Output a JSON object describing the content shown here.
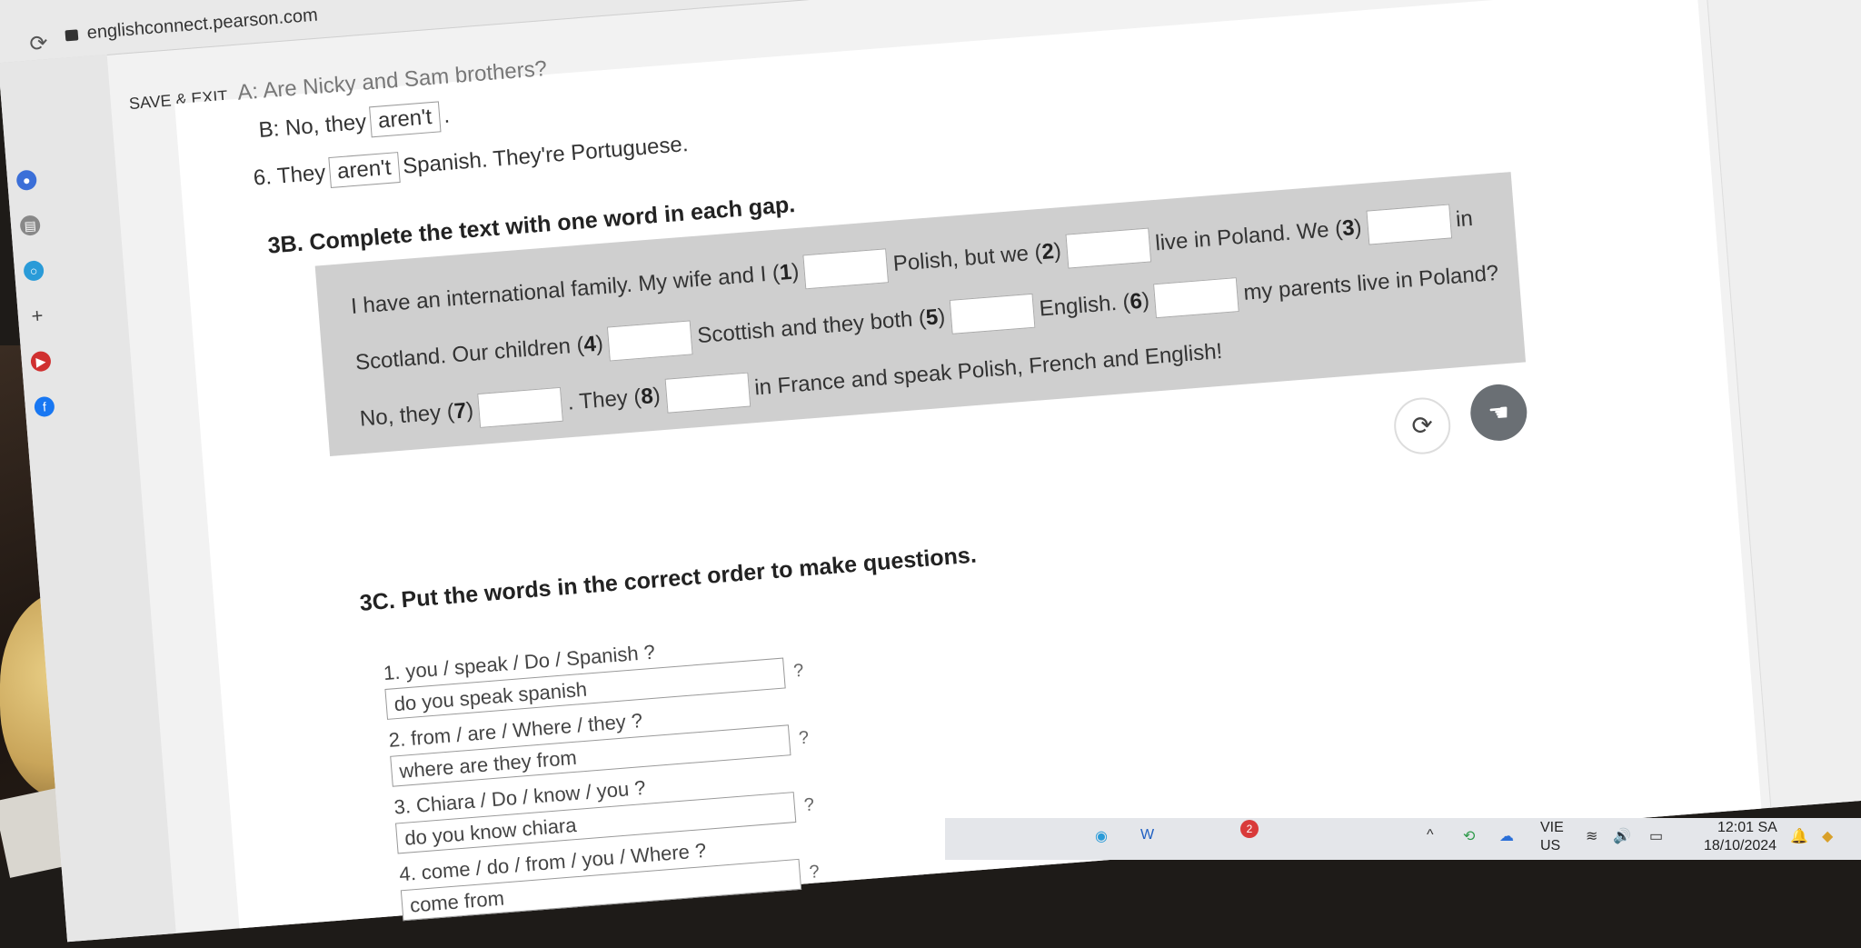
{
  "browser": {
    "url": "englishconnect.pearson.com"
  },
  "header": {
    "save_exit": "SAVE & EXIT"
  },
  "prev": {
    "line_partial": "A: Are Nicky and Sam brothers?",
    "line_b": "B: No, they",
    "line_b_answer": "aren't",
    "line_b_end": ".",
    "line6_start": "6. They",
    "line6_answer": "aren't",
    "line6_end": "Spanish. They're Portuguese."
  },
  "section_3b": {
    "title": "3B. Complete the text with one word in each gap.",
    "row1": {
      "a": "I have an international family. My wife and I (",
      "n1": "1",
      "b": ")",
      "c": "Polish, but we (",
      "n2": "2",
      "d": ")",
      "e": "live in Poland. We (",
      "n3": "3",
      "f": ")",
      "g": "in"
    },
    "row2": {
      "a": "Scotland. Our children (",
      "n4": "4",
      "b": ")",
      "c": "Scottish and they both (",
      "n5": "5",
      "d": ")",
      "e": "English. (",
      "n6": "6",
      "f": ")",
      "g": "my parents live in Poland?"
    },
    "row3": {
      "a": "No, they (",
      "n7": "7",
      "b": ")",
      "c": ". They (",
      "n8": "8",
      "d": ")",
      "e": "in France and speak Polish, French and English!"
    }
  },
  "section_3c": {
    "title": "3C. Put the words in the correct order to make questions.",
    "items": [
      {
        "prompt": "1. you / speak / Do / Spanish ?",
        "answer": "do you speak spanish"
      },
      {
        "prompt": "2. from / are / Where / they ?",
        "answer": "where are they from"
      },
      {
        "prompt": "3. Chiara / Do / know / you ?",
        "answer": "do you know chiara"
      },
      {
        "prompt": "4. come / do / from / you / Where ?",
        "answer": "come from"
      }
    ],
    "qmark": "?"
  },
  "taskbar": {
    "lang_top": "VIE",
    "lang_bottom": "US",
    "time": "12:01 SA",
    "date": "18/10/2024",
    "badge": "2"
  }
}
